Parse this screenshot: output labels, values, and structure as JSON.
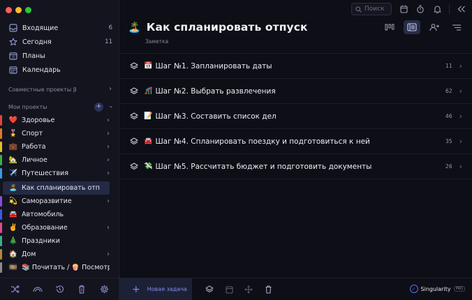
{
  "window": {
    "traffic_colors": [
      "#ff5f57",
      "#febc2e",
      "#28c840"
    ]
  },
  "sidebar": {
    "nav": [
      {
        "label": "Входящие",
        "count": "6",
        "icon": "inbox-icon"
      },
      {
        "label": "Сегодня",
        "count": "11",
        "icon": "star-icon"
      },
      {
        "label": "Планы",
        "count": "",
        "icon": "calendar-30-icon"
      },
      {
        "label": "Календарь",
        "count": "",
        "icon": "calendar-grid-icon"
      }
    ],
    "shared_projects": "Совместные проекты β",
    "my_projects": "Мои проекты",
    "projects": [
      {
        "emoji": "❤️",
        "label": "Здоровье",
        "color": "#e0443a",
        "has_children": true
      },
      {
        "emoji": "🎖️",
        "label": "Спорт",
        "color": "#e07a2a",
        "has_children": true
      },
      {
        "emoji": "💼",
        "label": "Работа",
        "color": "#e0c02a",
        "has_children": true
      },
      {
        "emoji": "🏡",
        "label": "Личное",
        "color": "#3ab04a",
        "has_children": true
      },
      {
        "emoji": "✈️",
        "label": "Путешествия",
        "color": "#3a9ae0",
        "has_children": true
      },
      {
        "emoji": "🏝️",
        "label": "Как спланировать отпуск",
        "color": "",
        "has_children": false,
        "active": true
      },
      {
        "emoji": "💫",
        "label": "Саморазвитие",
        "color": "#8a4ae0",
        "has_children": true
      },
      {
        "emoji": "🚘",
        "label": "Автомобиль",
        "color": "#3a5ae0",
        "has_children": false
      },
      {
        "emoji": "✌️",
        "label": "Образование",
        "color": "#e04a8a",
        "has_children": true
      },
      {
        "emoji": "🎄",
        "label": "Праздники",
        "color": "#3ab08a",
        "has_children": false
      },
      {
        "emoji": "🏠",
        "label": "Дом",
        "color": "#b08a3a",
        "has_children": true
      },
      {
        "emoji": "🎞️",
        "label": "📚 Почитать / 🍿 Посмотреть",
        "color": "#8a8a8a",
        "has_children": false
      }
    ]
  },
  "search": {
    "placeholder": "Поиск"
  },
  "page": {
    "emoji": "🏝️",
    "title": "Как спланировать отпуск",
    "subtitle": "Заметка"
  },
  "tasks": [
    {
      "emoji": "📅",
      "title": "Шаг №1. Запланировать даты",
      "count": "11"
    },
    {
      "emoji": "🎢",
      "title": "Шаг №2. Выбрать развлечения",
      "count": "62"
    },
    {
      "emoji": "📝",
      "title": "Шаг №3. Составить список дел",
      "count": "46"
    },
    {
      "emoji": "🚘",
      "title": "Шаг №4. Спланировать поездку и подготовиться к ней",
      "count": "35"
    },
    {
      "emoji": "💸",
      "title": "Шаг №5. Рассчитать бюджет и подготовить документы",
      "count": "26"
    }
  ],
  "bottom": {
    "new_task": "Новая задача",
    "brand": "Singularity",
    "brand_badge": "PRO"
  }
}
